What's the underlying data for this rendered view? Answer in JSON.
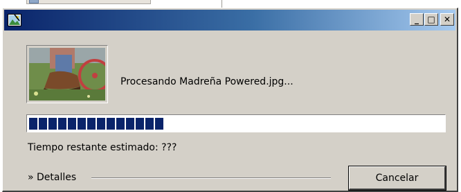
{
  "dialog": {
    "title": "",
    "app_icon": "picture-processing-icon",
    "title_buttons": {
      "minimize": "_",
      "maximize": "□",
      "close": "✕"
    },
    "thumbnail_icon": "photo-thumbnail",
    "processing_text": "Procesando Madreña Powered.jpg...",
    "progress_fraction": 0.34,
    "time_remaining_text": "Tiempo restante estimado: ???",
    "details_label": "» Detalles",
    "cancel_label": "Cancelar"
  },
  "colors": {
    "titlebar_start": "#0a246a",
    "titlebar_end": "#a6caf0",
    "progress_fill": "#0a246a",
    "window_face": "#d4d0c8"
  }
}
